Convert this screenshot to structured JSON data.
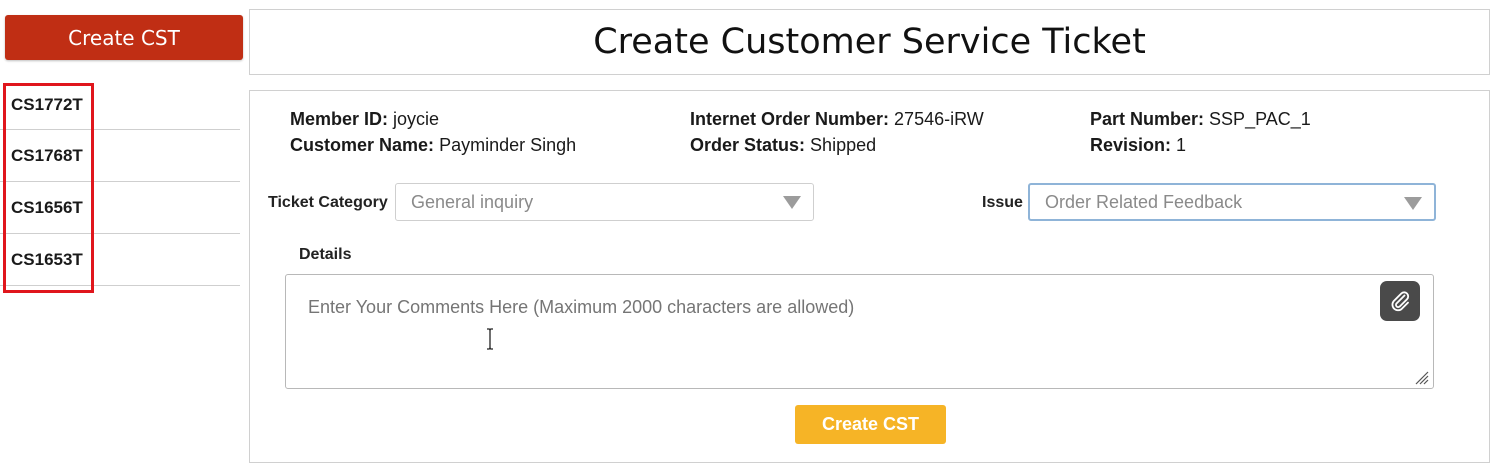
{
  "sidebar": {
    "create_button_label": "Create CST",
    "tickets": [
      "CS1772T",
      "CS1768T",
      "CS1656T",
      "CS1653T"
    ]
  },
  "header": {
    "title": "Create Customer Service Ticket"
  },
  "info": {
    "member_id_label": "Member ID:",
    "member_id": "joycie",
    "customer_name_label": "Customer Name:",
    "customer_name": "Payminder Singh",
    "internet_order_label": "Internet Order Number:",
    "internet_order": "27546-iRW",
    "order_status_label": "Order Status:",
    "order_status": "Shipped",
    "part_number_label": "Part Number:",
    "part_number": "SSP_PAC_1",
    "revision_label": "Revision:",
    "revision": "1"
  },
  "form": {
    "ticket_category_label": "Ticket Category",
    "ticket_category_value": "General inquiry",
    "issue_label": "Issue",
    "issue_value": "Order Related Feedback",
    "details_label": "Details",
    "details_placeholder": "Enter Your Comments Here (Maximum 2000 characters are allowed)",
    "submit_label": "Create CST"
  },
  "icons": {
    "attach": "paperclip-icon",
    "dropdown": "caret-down-icon",
    "resize": "resize-grip-icon"
  },
  "colors": {
    "primary_red": "#c02e14",
    "accent_yellow": "#f6b426",
    "highlight_red": "#e0161c",
    "focus_blue": "#8fb4d8"
  }
}
